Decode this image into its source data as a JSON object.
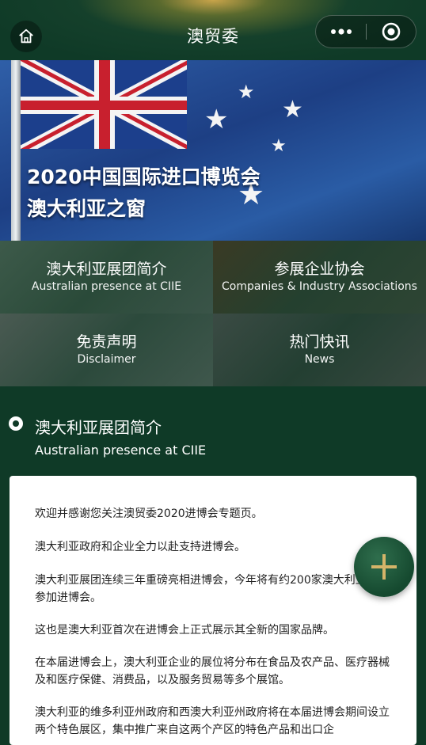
{
  "header": {
    "title": "澳贸委"
  },
  "banner": {
    "line1": "2020中国国际进口博览会",
    "line2": "澳大利亚之窗"
  },
  "nav": [
    {
      "cn": "澳大利亚展团简介",
      "en": "Australian presence at CIIE"
    },
    {
      "cn": "参展企业协会",
      "en": "Companies & Industry Associations"
    },
    {
      "cn": "免责声明",
      "en": "Disclaimer"
    },
    {
      "cn": "热门快讯",
      "en": "News"
    }
  ],
  "section": {
    "title_cn": "澳大利亚展团简介",
    "title_en": "Australian presence at CIIE"
  },
  "content": {
    "p1": "欢迎并感谢您关注澳贸委2020进博会专题页。",
    "p2": "澳大利亚政府和企业全力以赴支持进博会。",
    "p3": "澳大利亚展团连续三年重磅亮相进博会，今年将有约200家澳大利亚公司参加进博会。",
    "p4": "这也是澳大利亚首次在进博会上正式展示其全新的国家品牌。",
    "p5": "在本届进博会上，澳大利亚企业的展位将分布在食品及农产品、医疗器械及和医疗保健、消费品，以及服务贸易等多个展馆。",
    "p6": "澳大利亚的维多利亚州政府和西澳大利亚州政府将在本届进博会期间设立两个特色展区，集中推广来自这两个产区的特色产品和出口企"
  },
  "colors": {
    "background": "#0f3a27",
    "fab": "#1d5a3b",
    "fab_plus": "#d4b469"
  }
}
